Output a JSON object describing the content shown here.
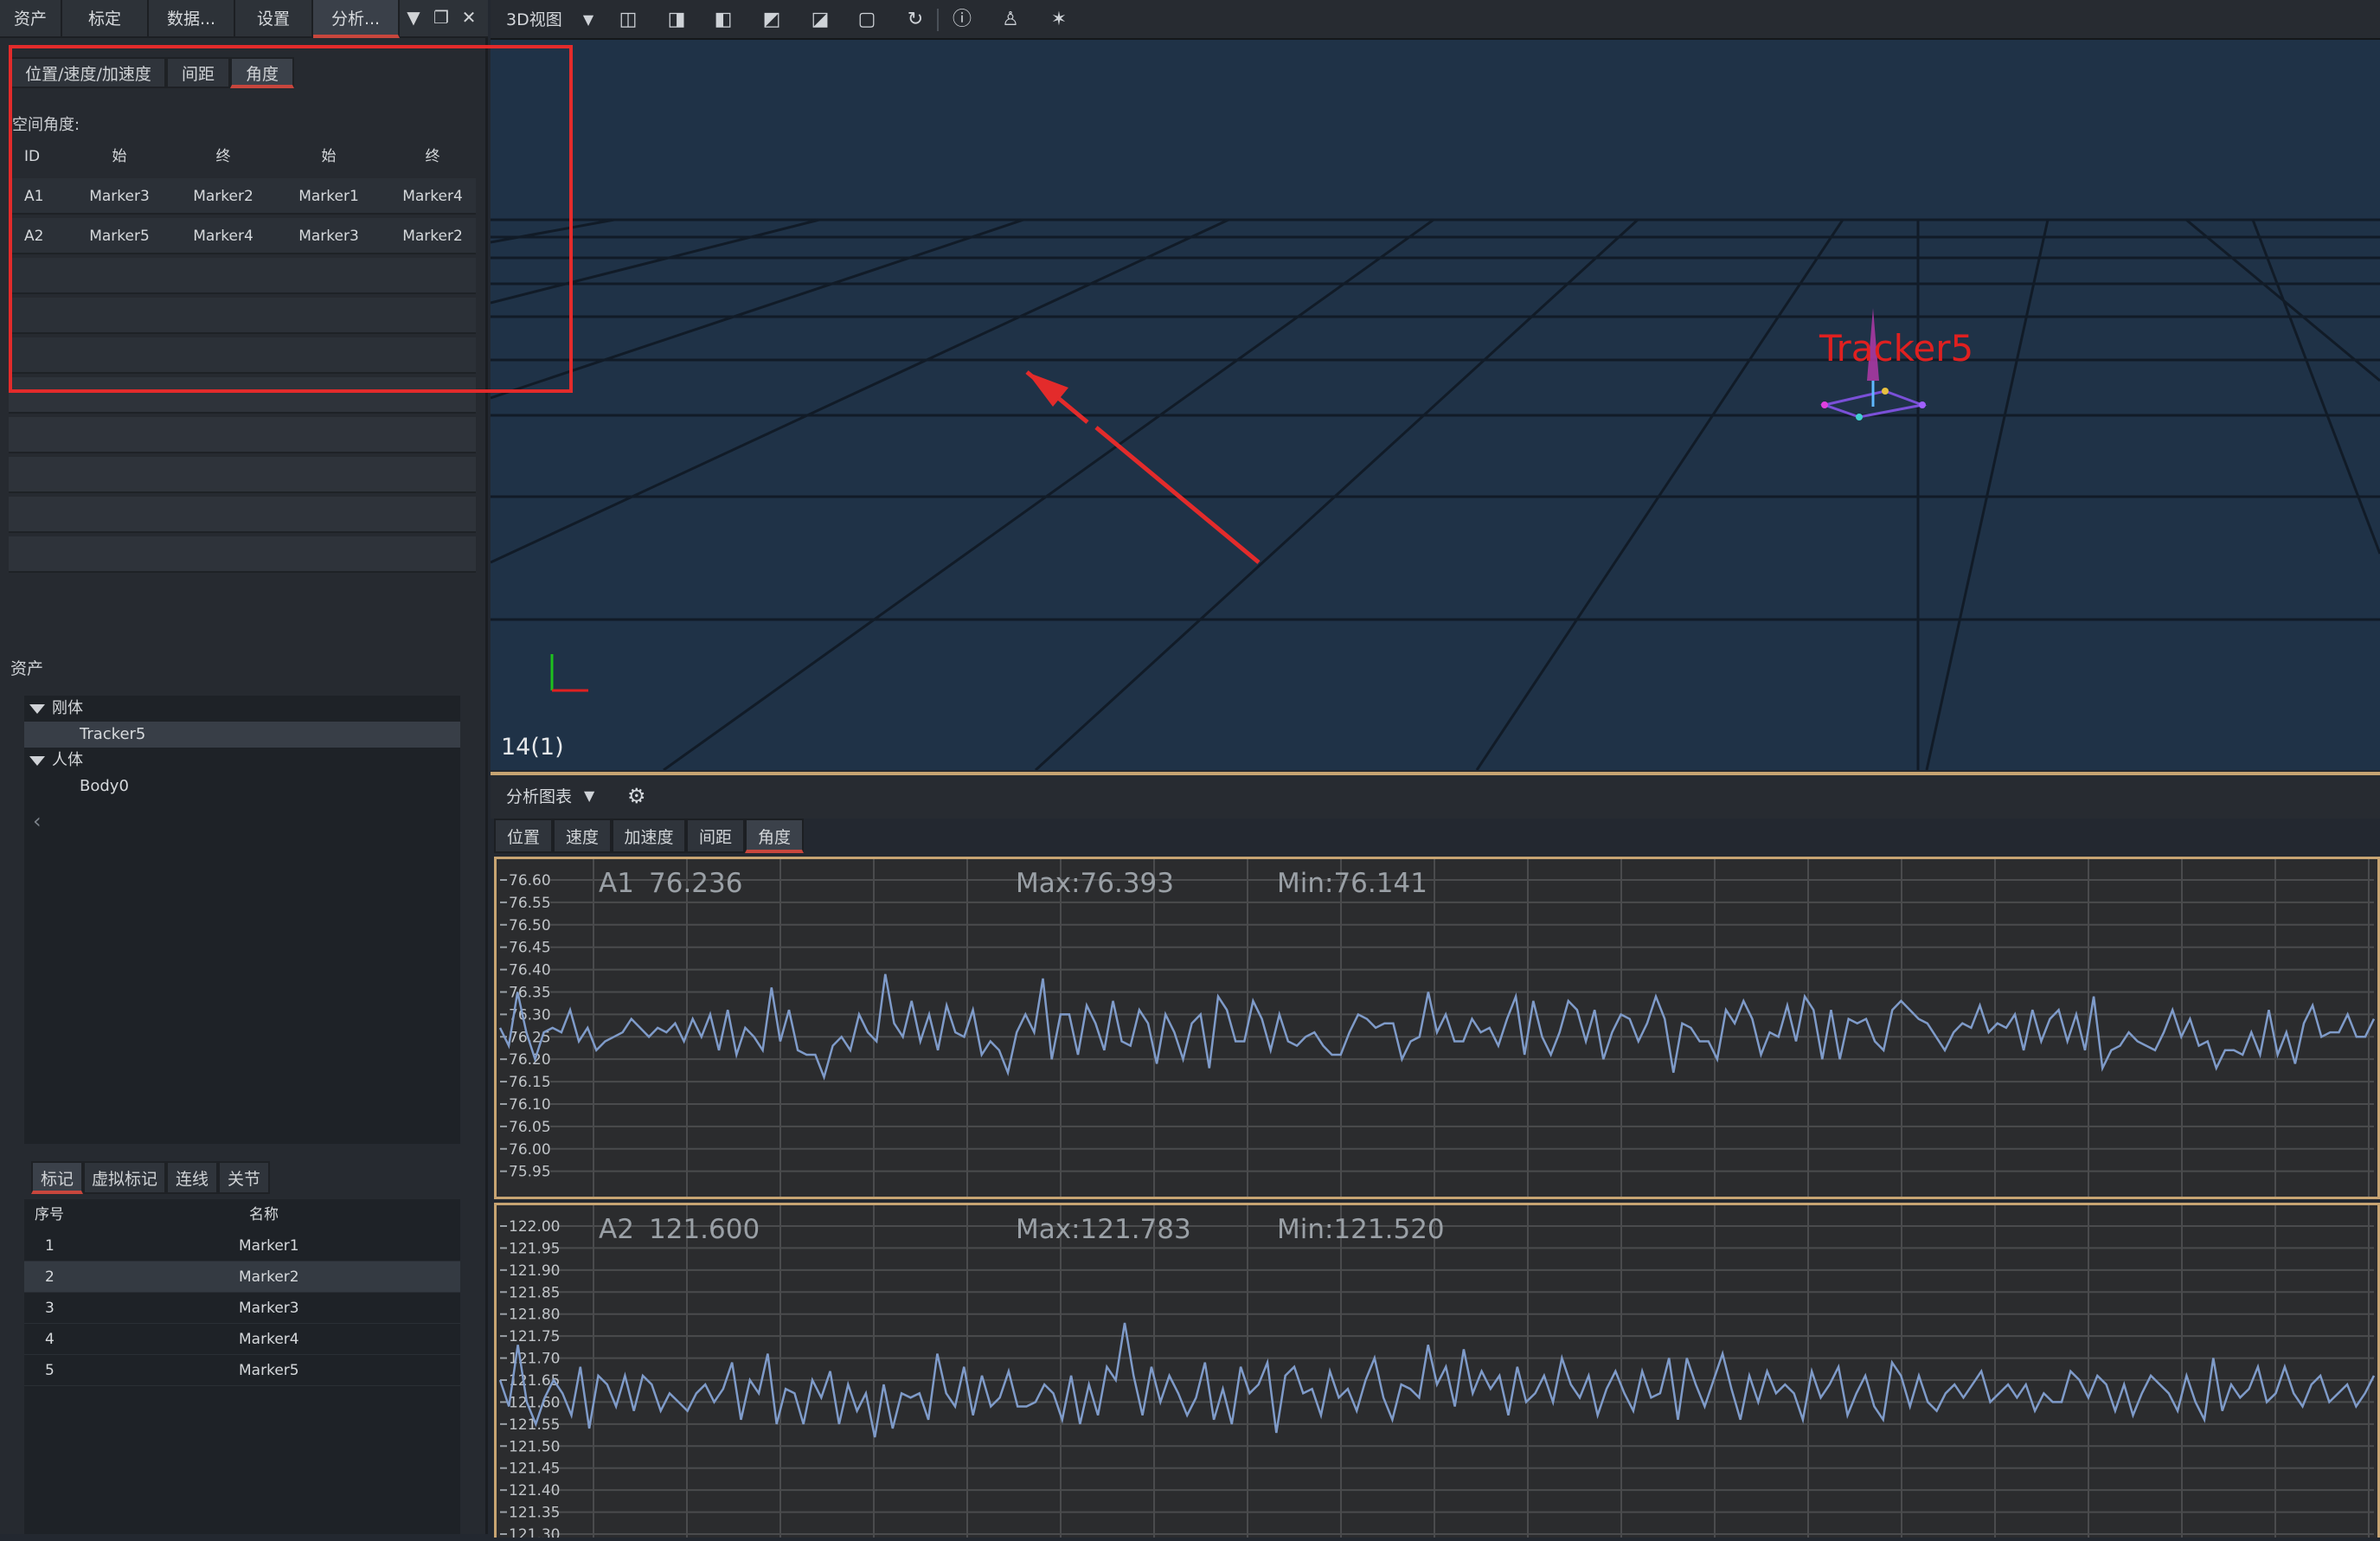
{
  "left_panel": {
    "top_tabs": [
      "资产",
      "标定",
      "数据...",
      "设置",
      "分析..."
    ],
    "sub_tabs": [
      "位置/速度/加速度",
      "间距",
      "角度"
    ],
    "section_label": "空间角度:",
    "table": {
      "headers": [
        "ID",
        "始",
        "终",
        "始",
        "终"
      ],
      "rows": [
        [
          "A1",
          "Marker3",
          "Marker2",
          "Marker1",
          "Marker4"
        ],
        [
          "A2",
          "Marker5",
          "Marker4",
          "Marker3",
          "Marker2"
        ]
      ]
    },
    "assets_label": "资产",
    "asset_tree": {
      "rigid_label": "刚体",
      "rigid_child": "Tracker5",
      "human_label": "人体",
      "human_child": "Body0",
      "collapse_glyph": "‹"
    },
    "marker_tabs": [
      "标记",
      "虚拟标记",
      "连线",
      "关节"
    ],
    "marker_list": {
      "headers": [
        "序号",
        "名称"
      ],
      "rows": [
        [
          "1",
          "Marker1"
        ],
        [
          "2",
          "Marker2"
        ],
        [
          "3",
          "Marker3"
        ],
        [
          "4",
          "Marker4"
        ],
        [
          "5",
          "Marker5"
        ]
      ]
    }
  },
  "viewport": {
    "view_label": "3D视图",
    "tracker_label": "Tracker5",
    "frame_label": "14(1)",
    "toolbar_icons": [
      "view-front-icon",
      "view-back-icon",
      "view-top-icon",
      "view-bottom-icon",
      "view-left-icon",
      "view-right-icon",
      "refresh-icon",
      "info-icon",
      "skeleton-icon",
      "pose-icon"
    ]
  },
  "chart_panel": {
    "title": "分析图表",
    "tabs": [
      "位置",
      "速度",
      "加速度",
      "间距",
      "角度"
    ]
  },
  "colors": {
    "accent_red": "#c8463d",
    "highlight_box": "#e32b2b",
    "chart_border": "#c7a472",
    "line_color": "#7f9bc9",
    "viewport_bg": "#1f3247",
    "tracker_label": "#e02020"
  },
  "chart_data": [
    {
      "type": "line",
      "id": "A1",
      "readout": "76.236",
      "max_label": "Max:76.393",
      "min_label": "Min:76.141",
      "ylim": [
        75.95,
        76.6
      ],
      "yticks": [
        "76.60",
        "76.55",
        "76.50",
        "76.45",
        "76.40",
        "76.35",
        "76.30",
        "76.25",
        "76.20",
        "76.15",
        "76.10",
        "76.05",
        "76.00",
        "75.95"
      ],
      "ytick_values": [
        76.6,
        76.55,
        76.5,
        76.45,
        76.4,
        76.35,
        76.3,
        76.25,
        76.2,
        76.15,
        76.1,
        76.05,
        76.0,
        75.95
      ],
      "series": [
        {
          "values": [
            76.27,
            76.23,
            76.35,
            76.26,
            76.2,
            76.26,
            76.27,
            76.26,
            76.31,
            76.24,
            76.27,
            76.22,
            76.24,
            76.25,
            76.26,
            76.29,
            76.27,
            76.25,
            76.27,
            76.26,
            76.28,
            76.24,
            76.29,
            76.25,
            76.3,
            76.22,
            76.31,
            76.21,
            76.27,
            76.25,
            76.22,
            76.36,
            76.24,
            76.31,
            76.22,
            76.21,
            76.21,
            76.16,
            76.23,
            76.25,
            76.22,
            76.3,
            76.26,
            76.24,
            76.39,
            76.28,
            76.25,
            76.33,
            76.24,
            76.3,
            76.22,
            76.32,
            76.26,
            76.25,
            76.31,
            76.21,
            76.24,
            76.22,
            76.17,
            76.26,
            76.3,
            76.26,
            76.38,
            76.2,
            76.3,
            76.3,
            76.21,
            76.32,
            76.28,
            76.22,
            76.33,
            76.24,
            76.23,
            76.31,
            76.28,
            76.19,
            76.3,
            76.26,
            76.2,
            76.28,
            76.3,
            76.18,
            76.34,
            76.31,
            76.24,
            76.24,
            76.33,
            76.29,
            76.22,
            76.3,
            76.24,
            76.23,
            76.25,
            76.26,
            76.23,
            76.21,
            76.21,
            76.26,
            76.3,
            76.29,
            76.27,
            76.28,
            76.28,
            76.2,
            76.24,
            76.25,
            76.35,
            76.26,
            76.3,
            76.24,
            76.24,
            76.29,
            76.26,
            76.27,
            76.23,
            76.29,
            76.34,
            76.21,
            76.33,
            76.25,
            76.21,
            76.26,
            76.33,
            76.31,
            76.24,
            76.31,
            76.2,
            76.26,
            76.3,
            76.29,
            76.24,
            76.28,
            76.34,
            76.29,
            76.17,
            76.28,
            76.27,
            76.24,
            76.24,
            76.2,
            76.31,
            76.28,
            76.33,
            76.29,
            76.21,
            76.26,
            76.25,
            76.32,
            76.24,
            76.34,
            76.31,
            76.2,
            76.31,
            76.2,
            76.29,
            76.28,
            76.29,
            76.24,
            76.22,
            76.31,
            76.33,
            76.31,
            76.29,
            76.28,
            76.25,
            76.22,
            76.26,
            76.28,
            76.27,
            76.32,
            76.26,
            76.28,
            76.27,
            76.3,
            76.22,
            76.31,
            76.24,
            76.29,
            76.31,
            76.24,
            76.3,
            76.22,
            76.34,
            76.18,
            76.22,
            76.23,
            76.26,
            76.24,
            76.23,
            76.22,
            76.26,
            76.31,
            76.25,
            76.29,
            76.23,
            76.24,
            76.18,
            76.22,
            76.22,
            76.21,
            76.26,
            76.21,
            76.31,
            76.21,
            76.26,
            76.19,
            76.28,
            76.32,
            76.25,
            76.26,
            76.26,
            76.3,
            76.25,
            76.25,
            76.29
          ]
        }
      ]
    },
    {
      "type": "line",
      "id": "A2",
      "readout": "121.600",
      "max_label": "Max:121.783",
      "min_label": "Min:121.520",
      "ylim": [
        121.3,
        122.0
      ],
      "yticks": [
        "122.00",
        "121.95",
        "121.90",
        "121.85",
        "121.80",
        "121.75",
        "121.70",
        "121.65",
        "121.60",
        "121.55",
        "121.50",
        "121.45",
        "121.40",
        "121.35",
        "121.30"
      ],
      "ytick_values": [
        122.0,
        121.95,
        121.9,
        121.85,
        121.8,
        121.75,
        121.7,
        121.65,
        121.6,
        121.55,
        121.5,
        121.45,
        121.4,
        121.35,
        121.3
      ],
      "series": [
        {
          "values": [
            121.65,
            121.59,
            121.73,
            121.6,
            121.55,
            121.61,
            121.65,
            121.62,
            121.57,
            121.68,
            121.54,
            121.66,
            121.64,
            121.59,
            121.66,
            121.58,
            121.66,
            121.64,
            121.58,
            121.62,
            121.6,
            121.58,
            121.62,
            121.64,
            121.6,
            121.63,
            121.69,
            121.56,
            121.65,
            121.62,
            121.71,
            121.55,
            121.63,
            121.62,
            121.55,
            121.65,
            121.61,
            121.67,
            121.55,
            121.64,
            121.58,
            121.62,
            121.52,
            121.64,
            121.54,
            121.62,
            121.61,
            121.62,
            121.56,
            121.71,
            121.62,
            121.59,
            121.68,
            121.57,
            121.66,
            121.59,
            121.61,
            121.67,
            121.59,
            121.59,
            121.6,
            121.64,
            121.62,
            121.56,
            121.66,
            121.55,
            121.64,
            121.57,
            121.68,
            121.65,
            121.78,
            121.66,
            121.57,
            121.68,
            121.6,
            121.66,
            121.62,
            121.57,
            121.61,
            121.69,
            121.56,
            121.63,
            121.55,
            121.68,
            121.62,
            121.64,
            121.69,
            121.53,
            121.66,
            121.68,
            121.62,
            121.63,
            121.57,
            121.67,
            121.61,
            121.63,
            121.58,
            121.65,
            121.7,
            121.61,
            121.56,
            121.64,
            121.63,
            121.61,
            121.73,
            121.64,
            121.68,
            121.59,
            121.72,
            121.62,
            121.67,
            121.63,
            121.66,
            121.57,
            121.68,
            121.6,
            121.62,
            121.66,
            121.6,
            121.7,
            121.64,
            121.61,
            121.66,
            121.57,
            121.63,
            121.67,
            121.62,
            121.58,
            121.67,
            121.61,
            121.62,
            121.7,
            121.56,
            121.7,
            121.64,
            121.59,
            121.65,
            121.71,
            121.63,
            121.56,
            121.66,
            121.6,
            121.67,
            121.62,
            121.64,
            121.62,
            121.56,
            121.67,
            121.61,
            121.64,
            121.68,
            121.57,
            121.62,
            121.66,
            121.59,
            121.56,
            121.69,
            121.66,
            121.59,
            121.66,
            121.6,
            121.58,
            121.62,
            121.64,
            121.61,
            121.64,
            121.67,
            121.6,
            121.62,
            121.64,
            121.61,
            121.64,
            121.58,
            121.62,
            121.6,
            121.6,
            121.67,
            121.65,
            121.61,
            121.66,
            121.64,
            121.58,
            121.64,
            121.57,
            121.62,
            121.66,
            121.64,
            121.62,
            121.58,
            121.66,
            121.6,
            121.56,
            121.7,
            121.58,
            121.64,
            121.61,
            121.63,
            121.68,
            121.6,
            121.62,
            121.68,
            121.62,
            121.59,
            121.64,
            121.66,
            121.6,
            121.62,
            121.64,
            121.59,
            121.62,
            121.66
          ]
        }
      ]
    }
  ]
}
